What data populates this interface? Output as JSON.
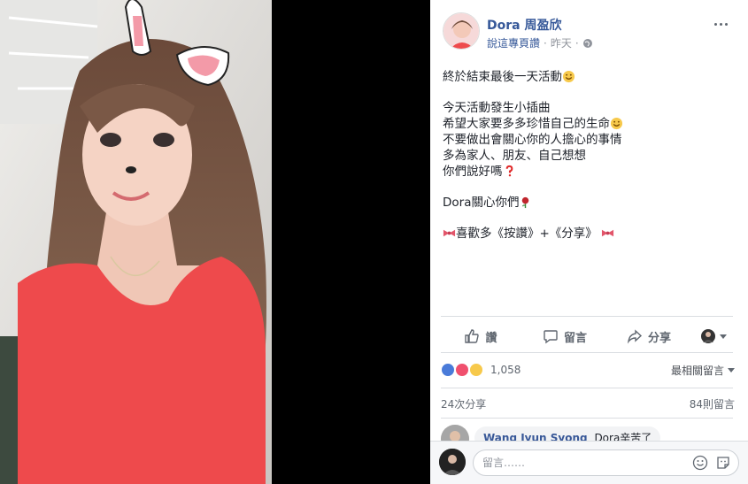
{
  "post": {
    "page_name": "Dora 周盈欣",
    "like_page": "說這專頁讚",
    "separator": "·",
    "time": "昨天",
    "lines": [
      "終於結束最後一天活動",
      "",
      "今天活動發生小插曲",
      "希望大家要多多珍惜自己的生命",
      "不要做出會關心你的人擔心的事情",
      "多為家人、朋友、自己想想",
      "你們說好嗎",
      "",
      "Dora關心你們",
      "",
      "喜歡多《按讚》+《分享》"
    ]
  },
  "actions": {
    "like": "讚",
    "comment": "留言",
    "share": "分享"
  },
  "reactions": {
    "count": "1,058",
    "sort_label": "最相關留言"
  },
  "stats": {
    "shares": "24次分享",
    "comments": "84則留言"
  },
  "comment": {
    "author": "Wang Jyun Syong",
    "text": "Dora辛苦了"
  },
  "composer": {
    "placeholder": "留言……"
  },
  "colors": {
    "link": "#365899",
    "shirt": "#ee4a4c"
  }
}
